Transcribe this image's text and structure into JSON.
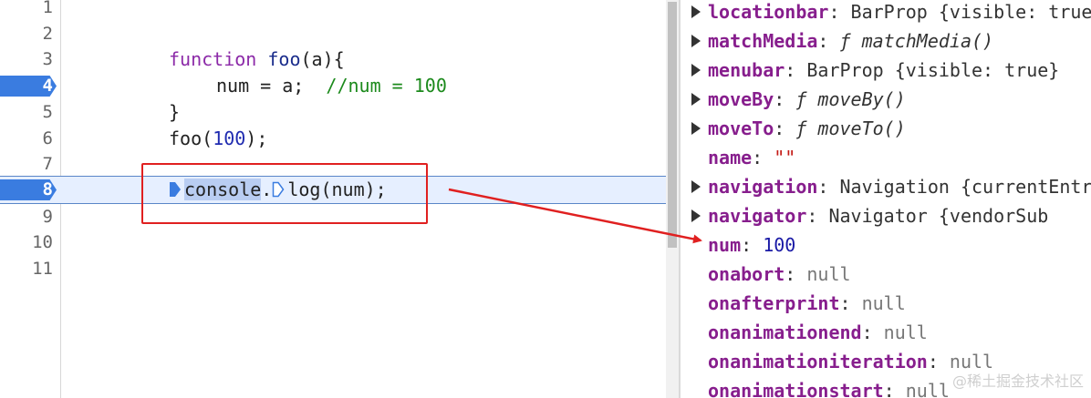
{
  "editor": {
    "lines": [
      {
        "number": "1",
        "text": ""
      },
      {
        "number": "2",
        "text": ""
      },
      {
        "number": "3",
        "text": "function foo(a){"
      },
      {
        "number": "4",
        "text": "    num = a;  //num = 100",
        "breakpoint": true
      },
      {
        "number": "5",
        "text": "}"
      },
      {
        "number": "6",
        "text": "foo(100);"
      },
      {
        "number": "7",
        "text": ""
      },
      {
        "number": "8",
        "text": "console.log(num);",
        "breakpoint": true,
        "active": true
      },
      {
        "number": "9",
        "text": ""
      },
      {
        "number": "10",
        "text": ""
      },
      {
        "number": "11",
        "text": ""
      }
    ],
    "line3": {
      "kw": "function",
      "name": "foo",
      "rest": "(a){"
    },
    "line4": {
      "code": "num = a;",
      "comment": "//num = 100"
    },
    "line5": "}",
    "line6": {
      "call": "foo(",
      "arg": "100",
      "end": ");"
    },
    "line8": {
      "obj": "console",
      "dot": ".",
      "method": "log(num);"
    }
  },
  "scope": {
    "properties": [
      {
        "key": "locationbar",
        "value": "BarProp {visible: true}",
        "expandable": true
      },
      {
        "key": "matchMedia",
        "value": "ƒ matchMedia()",
        "expandable": true,
        "kind": "function"
      },
      {
        "key": "menubar",
        "value": "BarProp {visible: true}",
        "expandable": true
      },
      {
        "key": "moveBy",
        "value": "ƒ moveBy()",
        "expandable": true,
        "kind": "function"
      },
      {
        "key": "moveTo",
        "value": "ƒ moveTo()",
        "expandable": true,
        "kind": "function"
      },
      {
        "key": "name",
        "value": "\"\"",
        "expandable": false,
        "kind": "string"
      },
      {
        "key": "navigation",
        "value": "Navigation {currentEntry",
        "expandable": true
      },
      {
        "key": "navigator",
        "value": "Navigator {vendorSub",
        "expandable": true
      },
      {
        "key": "num",
        "value": "100",
        "expandable": false,
        "kind": "number"
      },
      {
        "key": "onabort",
        "value": "null",
        "expandable": false,
        "kind": "null"
      },
      {
        "key": "onafterprint",
        "value": "null",
        "expandable": false,
        "kind": "null"
      },
      {
        "key": "onanimationend",
        "value": "null",
        "expandable": false,
        "kind": "null"
      },
      {
        "key": "onanimationiteration",
        "value": "null",
        "expandable": false,
        "kind": "null"
      },
      {
        "key": "onanimationstart",
        "value": "null",
        "expandable": false,
        "kind": "null"
      }
    ]
  },
  "watermark": "@稀土掘金技术社区",
  "colors": {
    "breakpoint": "#3a7ce0",
    "annotation": "#e02020",
    "active_line": "#e6efff"
  }
}
